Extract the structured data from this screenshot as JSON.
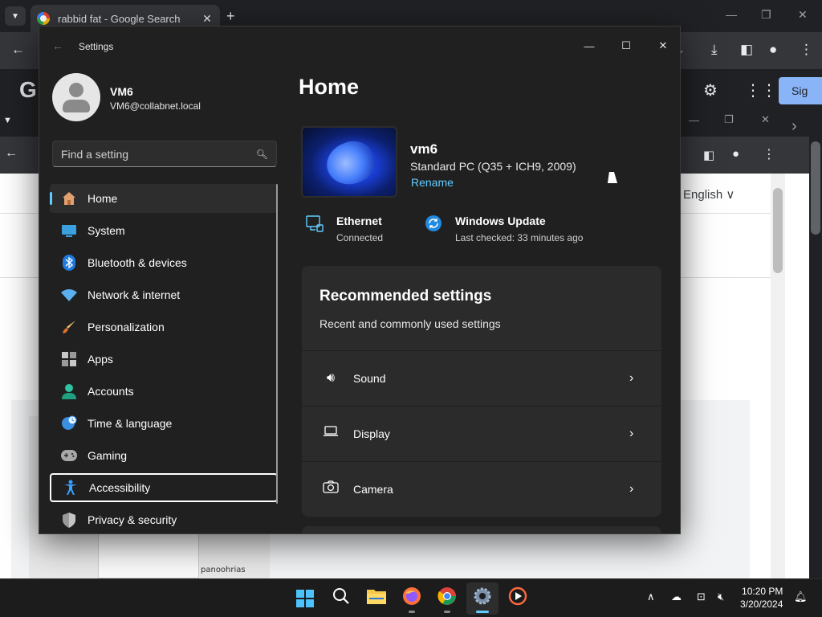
{
  "chrome": {
    "tab_title": "rabbid fat - Google Search",
    "sign_in_label": "Sig",
    "language_label": "English ∨",
    "sketch_text": "panoohrias",
    "google_letter": "G"
  },
  "settings": {
    "window_title": "Settings",
    "user": {
      "name": "VM6",
      "email": "VM6@collabnet.local"
    },
    "search": {
      "placeholder": "Find a setting"
    },
    "nav": [
      {
        "label": "Home",
        "icon": "home-icon"
      },
      {
        "label": "System",
        "icon": "system-icon"
      },
      {
        "label": "Bluetooth & devices",
        "icon": "bluetooth-icon"
      },
      {
        "label": "Network & internet",
        "icon": "wifi-icon"
      },
      {
        "label": "Personalization",
        "icon": "brush-icon"
      },
      {
        "label": "Apps",
        "icon": "apps-icon"
      },
      {
        "label": "Accounts",
        "icon": "accounts-icon"
      },
      {
        "label": "Time & language",
        "icon": "globe-clock-icon"
      },
      {
        "label": "Gaming",
        "icon": "gamepad-icon"
      },
      {
        "label": "Accessibility",
        "icon": "accessibility-icon"
      },
      {
        "label": "Privacy & security",
        "icon": "shield-icon"
      }
    ],
    "active_nav": "Home",
    "focused_nav": "Accessibility",
    "page_title": "Home",
    "device": {
      "name": "vm6",
      "description": "Standard PC (Q35 + ICH9, 2009)",
      "rename_label": "Rename"
    },
    "status": {
      "ethernet": {
        "title": "Ethernet",
        "subtitle": "Connected"
      },
      "update": {
        "title": "Windows Update",
        "subtitle": "Last checked: 33 minutes ago"
      }
    },
    "recommended": {
      "title": "Recommended settings",
      "subtitle": "Recent and commonly used settings",
      "items": [
        {
          "label": "Sound",
          "icon": "speaker-icon"
        },
        {
          "label": "Display",
          "icon": "laptop-icon"
        },
        {
          "label": "Camera",
          "icon": "camera-icon"
        }
      ]
    },
    "accent_color": "#60cdff"
  },
  "taskbar": {
    "apps": [
      "start",
      "search",
      "file-explorer",
      "firefox",
      "chrome",
      "settings",
      "media-player"
    ],
    "active_app": "settings",
    "time": "10:20 PM",
    "date": "3/20/2024"
  }
}
